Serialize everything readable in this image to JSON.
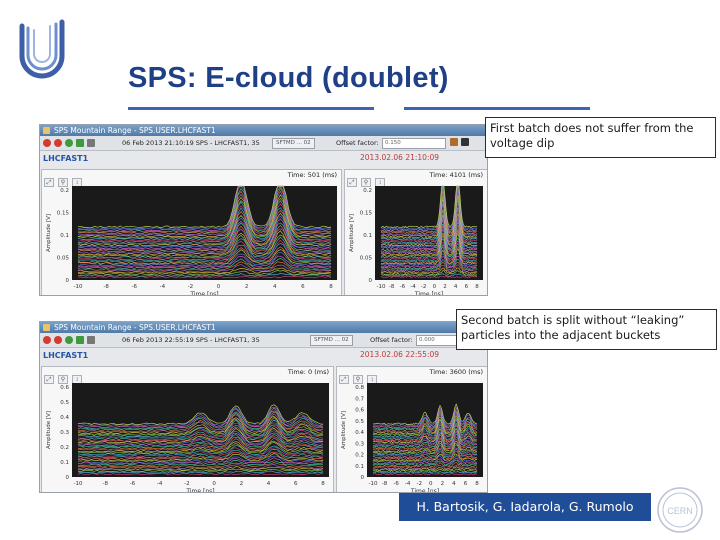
{
  "slide": {
    "title": "SPS: E-cloud (doublet)",
    "authors": "H. Bartosik, G. Iadarola, G. Rumolo",
    "callout_1": "First batch does not suffer from the voltage dip",
    "callout_2": "Second batch is split without “leaking” particles into the adjacent buckets",
    "logo_right_text": "CERN"
  },
  "windows": [
    {
      "title": "SPS Mountain Range - SPS.USER.LHCFAST1",
      "date": "06 Feb 2013   21:10:19  SPS - LHCFAST1, 35",
      "sftmd": "SFTMD ... 02",
      "offset_label": "Offset factor:",
      "offset_value": "0.150",
      "label": "LHCFAST1",
      "timestamp": "2013.02.06 21:10:09",
      "panels": [
        {
          "time": "Time: 501 (ms)",
          "yticks": [
            "0",
            "0.05",
            "0.1",
            "0.15",
            "0.2"
          ],
          "ylabel": "Amplitude [V]",
          "xticks": [
            "-10",
            "-8",
            "-6",
            "-4",
            "-2",
            "0",
            "2",
            "4",
            "6",
            "8"
          ],
          "xlabel": "Time [ns]"
        },
        {
          "time": "Time: 4101 (ms)",
          "yticks": [
            "0",
            "0.05",
            "0.1",
            "0.15",
            "0.2"
          ],
          "ylabel": "Amplitude [V]",
          "xticks": [
            "-10",
            "-8",
            "-6",
            "-4",
            "-2",
            "0",
            "2",
            "4",
            "6",
            "8"
          ],
          "xlabel": "Time [ns]"
        }
      ]
    },
    {
      "title": "SPS Mountain Range - SPS.USER.LHCFAST1",
      "date": "06 Feb 2013   22:55:19  SPS - LHCFAST1, 35",
      "sftmd": "SFTMD ... 02",
      "offset_label": "Offset factor:",
      "offset_value": "0.000",
      "label": "LHCFAST1",
      "timestamp": "2013.02.06 22:55:09",
      "panels": [
        {
          "time": "Time: 0 (ms)",
          "yticks": [
            "0",
            "0.1",
            "0.2",
            "0.3",
            "0.4",
            "0.5",
            "0.6"
          ],
          "ylabel": "Amplitude [V]",
          "xticks": [
            "-10",
            "-8",
            "-6",
            "-4",
            "-2",
            "0",
            "2",
            "4",
            "6",
            "8"
          ],
          "xlabel": "Time [ns]"
        },
        {
          "time": "Time: 3600 (ms)",
          "yticks": [
            "0",
            "0.1",
            "0.2",
            "0.3",
            "0.4",
            "0.5",
            "0.6",
            "0.7",
            "0.8"
          ],
          "ylabel": "Amplitude [V]",
          "xticks": [
            "-10",
            "-8",
            "-6",
            "-4",
            "-2",
            "0",
            "2",
            "4",
            "6",
            "8"
          ],
          "xlabel": "Time [ns]"
        }
      ]
    }
  ],
  "colors": {
    "title": "#1f3f86",
    "rule": "#3d63b8",
    "author_bg": "#1f4d98",
    "timestamp": "#bd3b3b"
  },
  "icons": [
    "u-logo-icon",
    "cern-logo-icon",
    "zoom-icon",
    "pan-icon",
    "play-icon",
    "stop-icon"
  ]
}
